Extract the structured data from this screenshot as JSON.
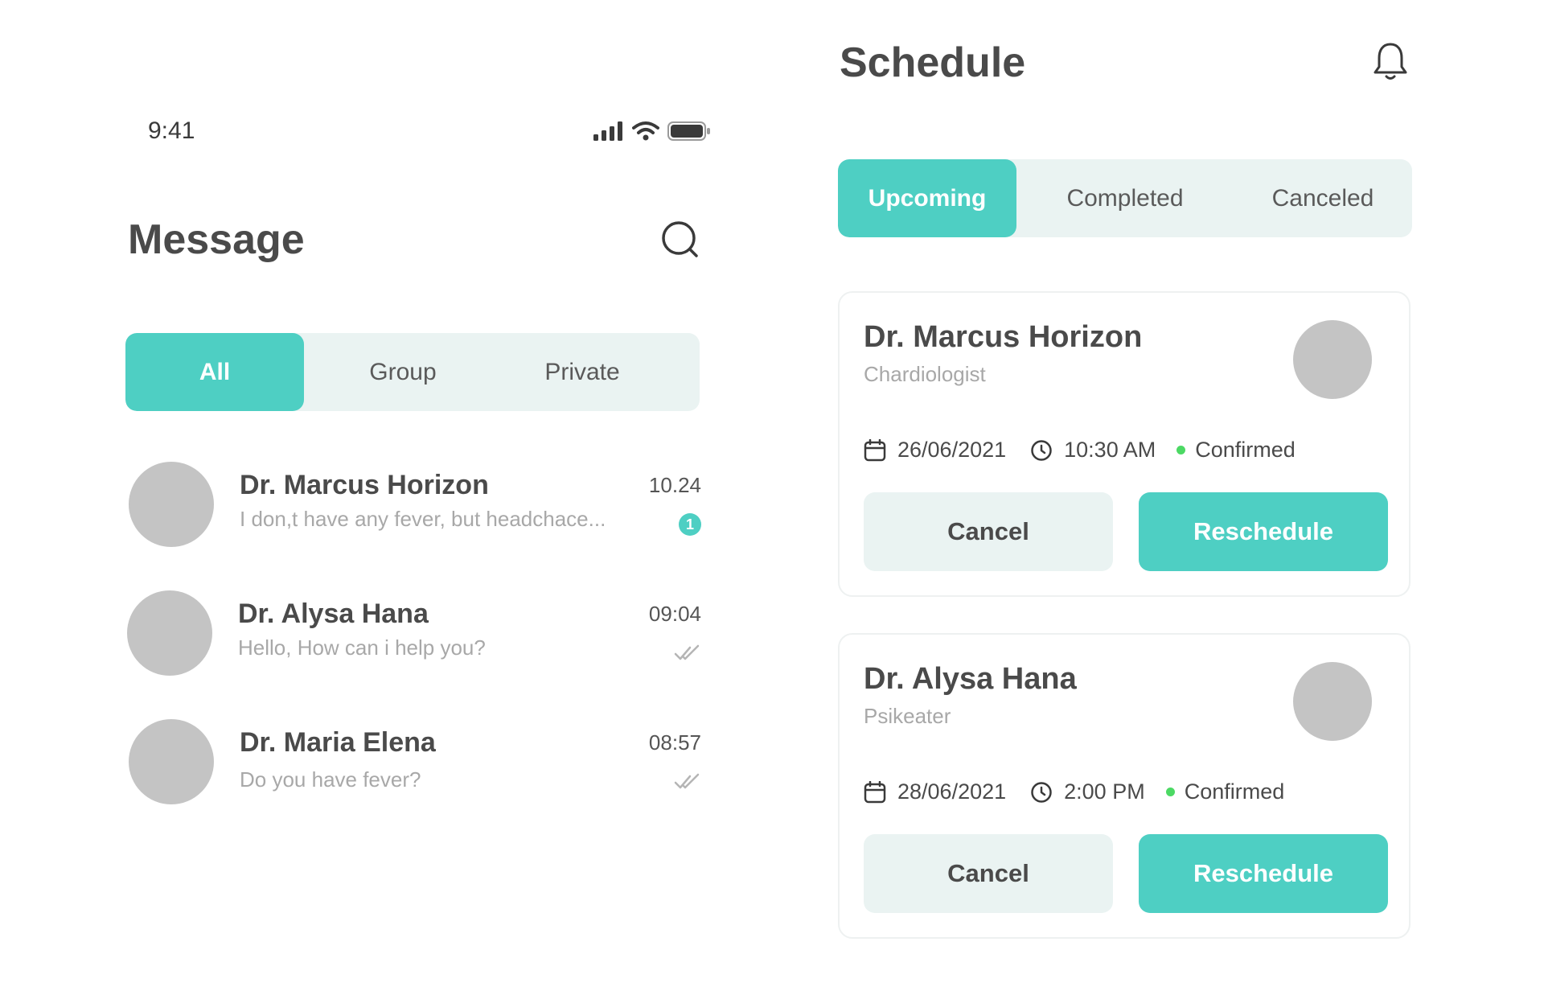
{
  "status_bar": {
    "time": "9:41"
  },
  "message": {
    "title": "Message",
    "tabs": [
      {
        "label": "All",
        "active": true
      },
      {
        "label": "Group",
        "active": false
      },
      {
        "label": "Private",
        "active": false
      }
    ],
    "chats": [
      {
        "name": "Dr. Marcus Horizon",
        "preview": "I don,t have any fever, but headchace...",
        "time": "10.24",
        "unread": "1"
      },
      {
        "name": "Dr. Alysa Hana",
        "preview": "Hello, How can i help you?",
        "time": "09:04",
        "read": true
      },
      {
        "name": "Dr. Maria Elena",
        "preview": "Do you have fever?",
        "time": "08:57",
        "read": true
      }
    ]
  },
  "schedule": {
    "title": "Schedule",
    "tabs": [
      {
        "label": "Upcoming",
        "active": true
      },
      {
        "label": "Completed",
        "active": false
      },
      {
        "label": "Canceled",
        "active": false
      }
    ],
    "appointments": [
      {
        "doctor": "Dr. Marcus Horizon",
        "specialty": "Chardiologist",
        "date": "26/06/2021",
        "time": "10:30 AM",
        "status": "Confirmed",
        "cancel_label": "Cancel",
        "reschedule_label": "Reschedule"
      },
      {
        "doctor": "Dr. Alysa Hana",
        "specialty": "Psikeater",
        "date": "28/06/2021",
        "time": "2:00 PM",
        "status": "Confirmed",
        "cancel_label": "Cancel",
        "reschedule_label": "Reschedule"
      }
    ]
  },
  "colors": {
    "accent": "#4ecfc3",
    "segment_bg": "#eaf3f2",
    "status_confirmed": "#4cd964",
    "avatar_placeholder": "#c4c4c4"
  },
  "icons": [
    "signal-icon",
    "wifi-icon",
    "battery-icon",
    "search-icon",
    "bell-icon",
    "calendar-icon",
    "clock-icon",
    "double-check-icon"
  ]
}
